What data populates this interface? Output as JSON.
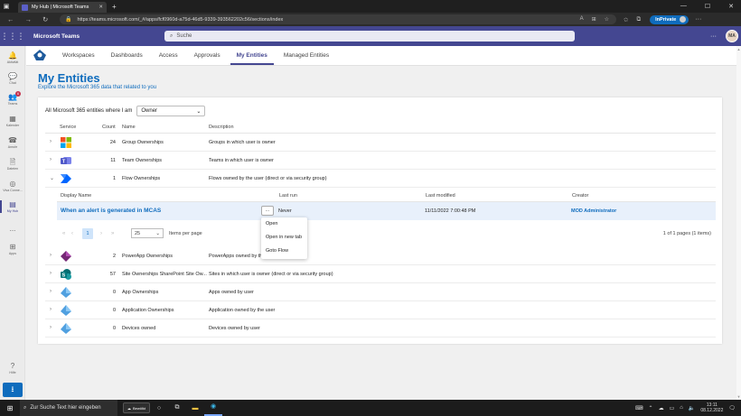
{
  "browser": {
    "tab_title": "My Hub | Microsoft Teams",
    "url": "https://teams.microsoft.com/_#/apps/fcf0960d-a75d-46d5-9339-393562202c56/sections/index",
    "inprivate_label": "InPrivate"
  },
  "teams": {
    "app_name": "Microsoft Teams",
    "search_placeholder": "Suche",
    "avatar_initials": "MA"
  },
  "rail": {
    "items": [
      {
        "label": "Aktivität",
        "icon": "bell-icon"
      },
      {
        "label": "Chat",
        "icon": "chat-icon"
      },
      {
        "label": "Teams",
        "icon": "teams-icon",
        "badge": "6"
      },
      {
        "label": "Kalender",
        "icon": "calendar-icon"
      },
      {
        "label": "Anrufe",
        "icon": "phone-icon"
      },
      {
        "label": "Dateien",
        "icon": "files-icon"
      },
      {
        "label": "Viva Conne...",
        "icon": "viva-icon"
      },
      {
        "label": "My Hub",
        "icon": "myhub-icon"
      },
      {
        "label": "...",
        "icon": "more-icon"
      },
      {
        "label": "Apps",
        "icon": "apps-icon"
      },
      {
        "label": "Hilfe",
        "icon": "help-icon"
      }
    ]
  },
  "app_tabs": [
    "Workspaces",
    "Dashboards",
    "Access",
    "Approvals",
    "My Entities",
    "Managed Entities"
  ],
  "page": {
    "title": "My Entities",
    "subtitle": "Explore the Microsoft 365 data that related to you",
    "filter_label": "All Microsoft 365 entities where I am",
    "filter_value": "Owner"
  },
  "table": {
    "headers": {
      "service": "Service",
      "count": "Count",
      "name": "Name",
      "description": "Description"
    },
    "rows": [
      {
        "count": "24",
        "name": "Group Ownerships",
        "description": "Groups in which user is owner",
        "icon": "office-icon",
        "expanded": false
      },
      {
        "count": "11",
        "name": "Team Ownerships",
        "description": "Teams in which user is owner",
        "icon": "teams-icon",
        "expanded": false
      },
      {
        "count": "1",
        "name": "Flow Ownerships",
        "description": "Flows owned by the user (direct or via security group)",
        "icon": "flow-icon",
        "expanded": true
      },
      {
        "count": "2",
        "name": "PowerApp Ownerships",
        "description": "PowerApps owned by the",
        "icon": "powerapps-icon",
        "expanded": false
      },
      {
        "count": "57",
        "name": "Site Ownerships SharePoint Site Ow...",
        "description": "Sites in which user is owner (direct or via security group)",
        "icon": "sharepoint-icon",
        "expanded": false
      },
      {
        "count": "0",
        "name": "App Ownerships",
        "description": "Apps owned by user",
        "icon": "azure-icon",
        "expanded": false
      },
      {
        "count": "0",
        "name": "Application Ownerships",
        "description": "Application owned by the user",
        "icon": "azure-icon",
        "expanded": false
      },
      {
        "count": "0",
        "name": "Devices owned",
        "description": "Devices owned by user",
        "icon": "azure-icon",
        "expanded": false
      }
    ]
  },
  "subtable": {
    "headers": {
      "display_name": "Display Name",
      "last_run": "Last run",
      "last_modified": "Last modified",
      "creator": "Creator"
    },
    "row": {
      "display_name": "When an alert is generated in MCAS",
      "more": "...",
      "last_run": "Never",
      "last_modified": "11/11/2022 7:00:48 PM",
      "creator": "MOD Administrator"
    },
    "pager": {
      "page": "1",
      "page_size": "25",
      "items_per_page": "Items per page",
      "info": "1 of 1 pages (1 items)"
    }
  },
  "context_menu": [
    "Open",
    "Open in new tab",
    "Goto Flow"
  ],
  "taskbar": {
    "search_placeholder": "Zur Suche Text hier eingeben",
    "weather": "Bewölkt",
    "time": "13:11",
    "date": "08.12.2022"
  }
}
